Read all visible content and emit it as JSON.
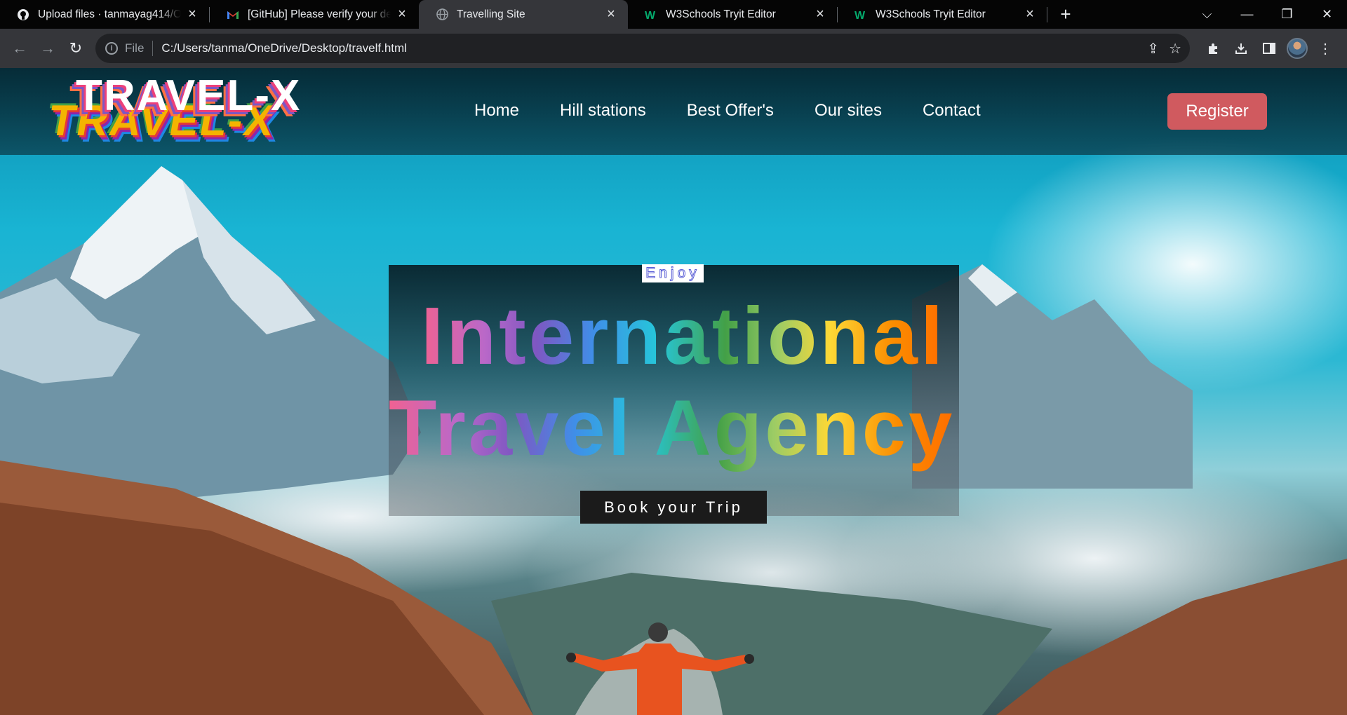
{
  "browser": {
    "tabs": [
      {
        "title": "Upload files · tanmayag414/OCTAVE",
        "icon": "github-icon",
        "active": false
      },
      {
        "title": "[GitHub] Please verify your device",
        "icon": "gmail-icon",
        "active": false
      },
      {
        "title": "Travelling Site",
        "icon": "globe-icon",
        "active": true
      },
      {
        "title": "W3Schools Tryit Editor",
        "icon": "w3schools-icon",
        "active": false
      },
      {
        "title": "W3Schools Tryit Editor",
        "icon": "w3schools-icon",
        "active": false
      }
    ],
    "address": {
      "scheme_label": "File",
      "url": "C:/Users/tanma/OneDrive/Desktop/travelf.html"
    }
  },
  "site": {
    "logo_text": "TRAVEL-X",
    "nav": [
      "Home",
      "Hill stations",
      "Best Offer's",
      "Our sites",
      "Contact"
    ],
    "register_label": "Register",
    "hero": {
      "kicker": "Enjoy",
      "line1": "International",
      "line2": "Travel Agency",
      "cta": "Book your Trip"
    }
  },
  "colors": {
    "register_bg": "#d05a5f",
    "cta_bg": "#1b1b1b",
    "header_bg": "#05232d"
  }
}
